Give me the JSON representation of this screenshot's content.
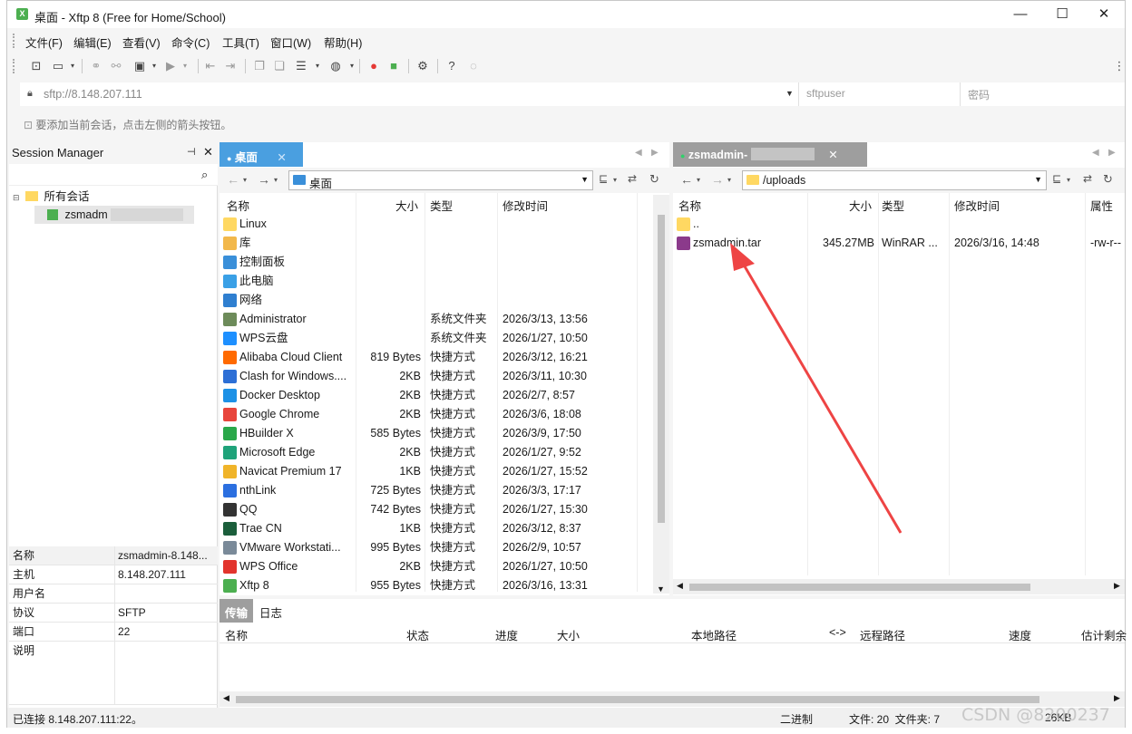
{
  "window": {
    "title": "桌面 - Xftp 8 (Free for Home/School)",
    "app_icon_letter": "X"
  },
  "menu": [
    "文件(F)",
    "编辑(E)",
    "查看(V)",
    "命令(C)",
    "工具(T)",
    "窗口(W)",
    "帮助(H)"
  ],
  "address": {
    "url": "sftp://8.148.207.111",
    "user_placeholder": "sftpuser",
    "password_placeholder": "密码"
  },
  "hint": "要添加当前会话，点击左侧的箭头按钮。",
  "session_manager": {
    "title": "Session Manager",
    "tree": [
      {
        "label": "所有会话"
      },
      {
        "label": "zsmadm"
      }
    ],
    "properties": [
      {
        "key": "名称",
        "value": "zsmadmin-8.148..."
      },
      {
        "key": "主机",
        "value": "8.148.207.111"
      },
      {
        "key": "用户名",
        "value": ""
      },
      {
        "key": "协议",
        "value": "SFTP"
      },
      {
        "key": "端口",
        "value": "22"
      },
      {
        "key": "说明",
        "value": ""
      }
    ]
  },
  "left_pane": {
    "tab": "桌面",
    "path": "桌面",
    "columns": [
      "名称",
      "大小",
      "类型",
      "修改时间"
    ],
    "files": [
      {
        "name": "Linux",
        "size": "",
        "type": "",
        "modified": "",
        "icon": "folder-icon",
        "color": "#ffd862"
      },
      {
        "name": "库",
        "size": "",
        "type": "",
        "modified": "",
        "icon": "library-icon",
        "color": "#f2b84b"
      },
      {
        "name": "控制面板",
        "size": "",
        "type": "",
        "modified": "",
        "icon": "control-panel-icon",
        "color": "#3a8fd9"
      },
      {
        "name": "此电脑",
        "size": "",
        "type": "",
        "modified": "",
        "icon": "computer-icon",
        "color": "#3aa0e6"
      },
      {
        "name": "网络",
        "size": "",
        "type": "",
        "modified": "",
        "icon": "network-icon",
        "color": "#2f7fd0"
      },
      {
        "name": "Administrator",
        "size": "",
        "type": "系统文件夹",
        "modified": "2026/3/13, 13:56",
        "icon": "user-folder-icon",
        "color": "#6d8b5a"
      },
      {
        "name": "WPS云盘",
        "size": "",
        "type": "系统文件夹",
        "modified": "2026/1/27, 10:50",
        "icon": "cloud-icon",
        "color": "#1e90ff"
      },
      {
        "name": "Alibaba Cloud Client",
        "size": "819 Bytes",
        "type": "快捷方式",
        "modified": "2026/3/12, 16:21",
        "icon": "alibaba-icon",
        "color": "#ff6a00"
      },
      {
        "name": "Clash for Windows....",
        "size": "2KB",
        "type": "快捷方式",
        "modified": "2026/3/11, 10:30",
        "icon": "clash-icon",
        "color": "#2d6fd6"
      },
      {
        "name": "Docker Desktop",
        "size": "2KB",
        "type": "快捷方式",
        "modified": "2026/2/7, 8:57",
        "icon": "docker-icon",
        "color": "#1d91e6"
      },
      {
        "name": "Google Chrome",
        "size": "2KB",
        "type": "快捷方式",
        "modified": "2026/3/6, 18:08",
        "icon": "chrome-icon",
        "color": "#e8453c"
      },
      {
        "name": "HBuilder X",
        "size": "585 Bytes",
        "type": "快捷方式",
        "modified": "2026/3/9, 17:50",
        "icon": "hbuilder-icon",
        "color": "#2aa84a"
      },
      {
        "name": "Microsoft Edge",
        "size": "2KB",
        "type": "快捷方式",
        "modified": "2026/1/27, 9:52",
        "icon": "edge-icon",
        "color": "#1fa37a"
      },
      {
        "name": "Navicat Premium 17",
        "size": "1KB",
        "type": "快捷方式",
        "modified": "2026/1/27, 15:52",
        "icon": "navicat-icon",
        "color": "#f0b429"
      },
      {
        "name": "nthLink",
        "size": "725 Bytes",
        "type": "快捷方式",
        "modified": "2026/3/3, 17:17",
        "icon": "nthlink-icon",
        "color": "#2b6fe0"
      },
      {
        "name": "QQ",
        "size": "742 Bytes",
        "type": "快捷方式",
        "modified": "2026/1/27, 15:30",
        "icon": "qq-icon",
        "color": "#333333"
      },
      {
        "name": "Trae CN",
        "size": "1KB",
        "type": "快捷方式",
        "modified": "2026/3/12, 8:37",
        "icon": "trae-icon",
        "color": "#1b5e3b"
      },
      {
        "name": "VMware Workstati...",
        "size": "995 Bytes",
        "type": "快捷方式",
        "modified": "2026/2/9, 10:57",
        "icon": "vmware-icon",
        "color": "#7a8a99"
      },
      {
        "name": "WPS Office",
        "size": "2KB",
        "type": "快捷方式",
        "modified": "2026/1/27, 10:50",
        "icon": "wps-icon",
        "color": "#e2342d"
      },
      {
        "name": "Xftp 8",
        "size": "955 Bytes",
        "type": "快捷方式",
        "modified": "2026/3/16, 13:31",
        "icon": "xftp-icon",
        "color": "#4caf50"
      }
    ]
  },
  "right_pane": {
    "tab": "zsmadmin-",
    "path": "/uploads",
    "columns": [
      "名称",
      "大小",
      "类型",
      "修改时间",
      "属性"
    ],
    "files": [
      {
        "name": "..",
        "size": "",
        "type": "",
        "modified": "",
        "attr": "",
        "icon": "folder-icon",
        "color": "#ffd862"
      },
      {
        "name": "zsmadmin.tar",
        "size": "345.27MB",
        "type": "WinRAR ...",
        "modified": "2026/3/16, 14:48",
        "attr": "-rw-r--",
        "icon": "winrar-icon",
        "color": "#8b3a8b"
      }
    ]
  },
  "transfer": {
    "tabs": [
      "传输",
      "日志"
    ],
    "columns": [
      "名称",
      "状态",
      "进度",
      "大小",
      "本地路径",
      "<->",
      "远程路径",
      "速度",
      "估计剩余"
    ]
  },
  "status": {
    "connection": "已连接 8.148.207.111:22。",
    "mode": "二进制",
    "counts": "文件: 20  文件夹: 7",
    "size": "26KB"
  },
  "watermark": "CSDN @8200237",
  "colors": {
    "accent_tab": "#4a9fe0",
    "arrow": "#ee4444"
  }
}
